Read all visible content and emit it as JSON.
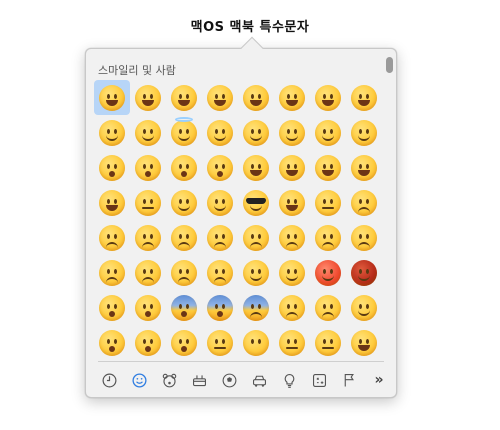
{
  "page_title": "맥OS 맥북 특수문자",
  "picker": {
    "category_title": "스마일리 및 사람",
    "selected_index": 0,
    "emojis": [
      "grinning-face",
      "grinning-face-big-eyes",
      "grinning-face-smiling-eyes",
      "beaming-face",
      "grinning-squinting-face",
      "grinning-face-with-sweat",
      "face-with-tears-of-joy",
      "rolling-on-the-floor-laughing",
      "smiling-face",
      "smiling-face-with-smiling-eyes",
      "smiling-face-with-halo",
      "slightly-smiling-face",
      "upside-down-face",
      "winking-face",
      "relieved-face",
      "smiling-face-with-heart-eyes",
      "face-blowing-a-kiss",
      "kissing-face",
      "kissing-face-with-smiling-eyes",
      "kissing-face-with-closed-eyes",
      "face-savoring-food",
      "face-with-tongue",
      "squinting-face-with-tongue",
      "winking-face-with-tongue",
      "zany-face",
      "face-with-raised-eyebrow",
      "face-with-monocle",
      "nerd-face",
      "smiling-face-with-sunglasses",
      "star-struck",
      "smirking-face",
      "unamused-face",
      "disappointed-face",
      "pensive-face",
      "worried-face",
      "confused-face",
      "slightly-frowning-face",
      "frowning-face",
      "persevering-face",
      "confounded-face",
      "tired-face",
      "weary-face",
      "crying-face",
      "loudly-crying-face",
      "face-with-steam-from-nose",
      "angry-face",
      "pouting-face",
      "face-with-symbols-on-mouth",
      "exploding-head",
      "flushed-face",
      "face-screaming-in-fear",
      "fearful-face",
      "anxious-face-with-sweat",
      "sad-but-relieved-face",
      "downcast-face-with-sweat",
      "hugging-face",
      "thinking-face",
      "face-with-hand-over-mouth",
      "shushing-face",
      "lying-face",
      "face-without-mouth",
      "neutral-face",
      "expressionless-face",
      "grimacing-face"
    ],
    "tabs": [
      {
        "icon": "clock-icon"
      },
      {
        "icon": "smiley-icon"
      },
      {
        "icon": "bear-icon"
      },
      {
        "icon": "food-icon"
      },
      {
        "icon": "soccer-ball-icon"
      },
      {
        "icon": "car-icon"
      },
      {
        "icon": "lightbulb-icon"
      },
      {
        "icon": "symbols-icon"
      },
      {
        "icon": "flag-icon"
      },
      {
        "icon": "more-icon",
        "label": "»"
      }
    ],
    "active_tab": 1,
    "accent_color": "#2f7de1"
  }
}
